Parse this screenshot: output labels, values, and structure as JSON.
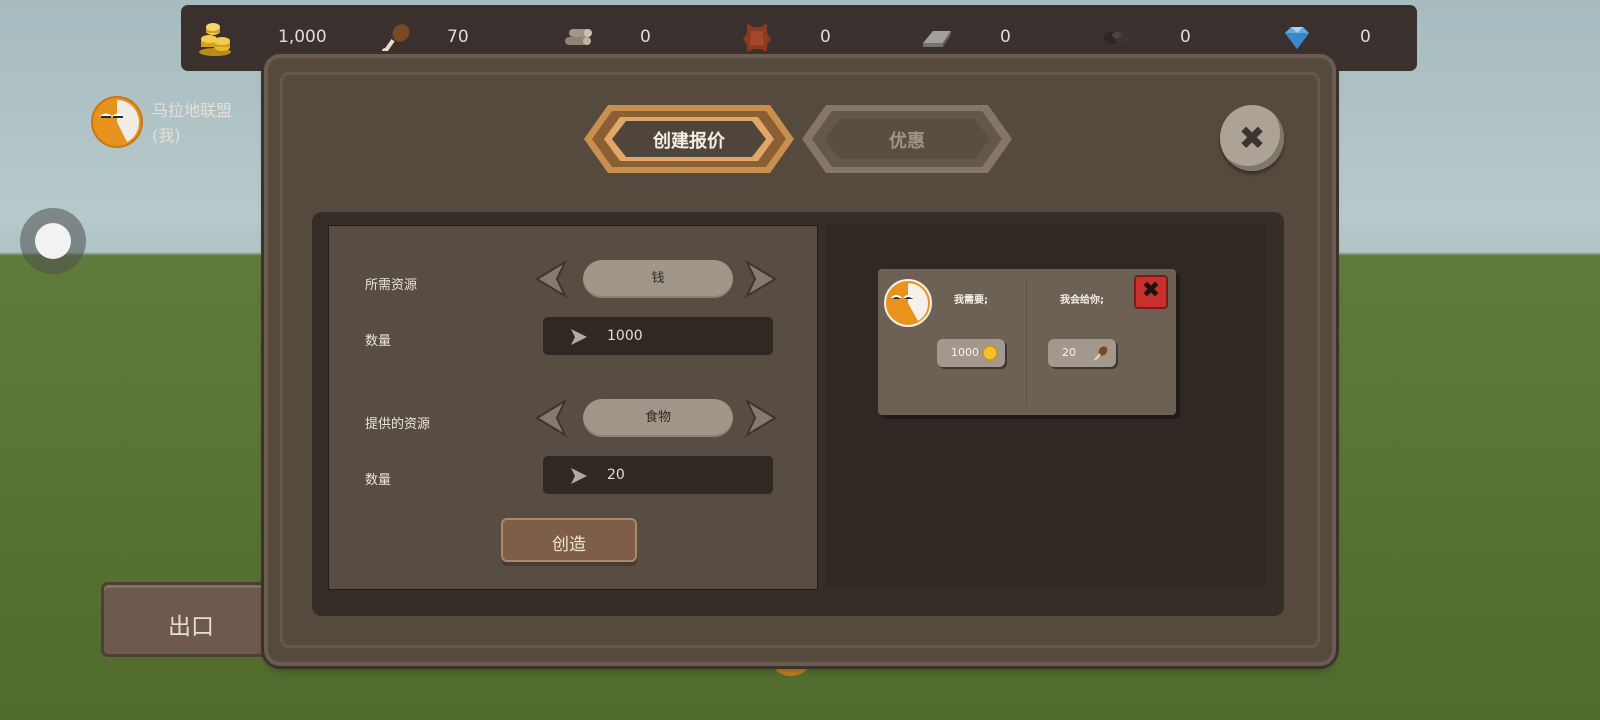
{
  "resources": [
    {
      "icon": "gold-coins-icon",
      "value": "1,000"
    },
    {
      "icon": "meat-drumstick-icon",
      "value": "70"
    },
    {
      "icon": "wood-logs-icon",
      "value": "0"
    },
    {
      "icon": "leather-hide-icon",
      "value": "0"
    },
    {
      "icon": "iron-ingot-icon",
      "value": "0"
    },
    {
      "icon": "coal-icon",
      "value": "0"
    },
    {
      "icon": "diamond-icon",
      "value": "0"
    }
  ],
  "player": {
    "name_line1": "马拉地联盟",
    "name_line2": "(我)"
  },
  "exit_label": "出口",
  "tabs": {
    "create": "创建报价",
    "offers": "优惠"
  },
  "close_glyph": "✖",
  "form": {
    "required_label": "所需资源",
    "required_value": "钱",
    "required_qty_label": "数量",
    "required_qty": "1000",
    "offered_label": "提供的资源",
    "offered_value": "食物",
    "offered_qty_label": "数量",
    "offered_qty": "20",
    "create_button": "创造"
  },
  "offer_card": {
    "need_label": "我需要;",
    "give_label": "我会给你;",
    "need_amount": "1000",
    "give_amount": "20",
    "remove_glyph": "✖"
  },
  "colors": {
    "accent_tab": "#c98f4e",
    "panel": "#564a3f",
    "close_red": "#c8302b"
  }
}
